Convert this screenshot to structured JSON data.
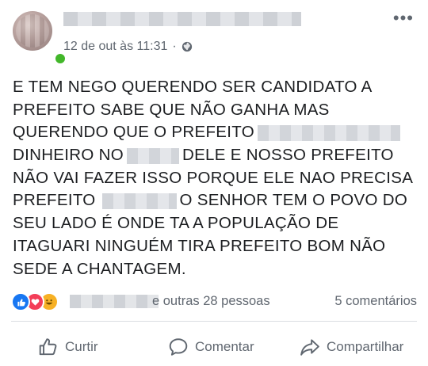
{
  "post": {
    "author_name": "",
    "timestamp": "12 de out às 11:31",
    "separator": "·",
    "privacy_icon": "globe-icon",
    "menu_icon": "more-options-icon",
    "text_lines": [
      [
        "E TEM NEGO QUERENDO SER CANDIDATO A"
      ],
      [
        "PREFEITO SABE QUE NÃO GANHA MAS"
      ],
      [
        "QUERENDO QUE O PREFEITO"
      ],
      [
        "DINHEIRO NO",
        "DELE E NOSSO PREFEITO"
      ],
      [
        "NÃO VAI FAZER ISSO PORQUE ELE NAO PRECISA"
      ],
      [
        "PREFEITO",
        "O SENHOR TEM O POVO DO"
      ],
      [
        "SEU LADO É ONDE TA A POPULAÇÃO DE"
      ],
      [
        "ITAGUARI NINGUÉM TIRA PREFEITO BOM NÃO"
      ],
      [
        "SEDE A CHANTAGEM."
      ]
    ]
  },
  "reactions": {
    "icons": [
      "like-icon",
      "love-icon",
      "haha-icon"
    ],
    "others_text": "e outras 28 pessoas",
    "comments_text": "5 comentários"
  },
  "actions": {
    "like_label": "Curtir",
    "comment_label": "Comentar",
    "share_label": "Compartilhar"
  },
  "colors": {
    "text": "#1c1e21",
    "secondary_text": "#606770",
    "like_blue": "#1877f2",
    "love_red": "#f33e58",
    "haha_yellow": "#f7b125",
    "online_green": "#42b72a"
  }
}
